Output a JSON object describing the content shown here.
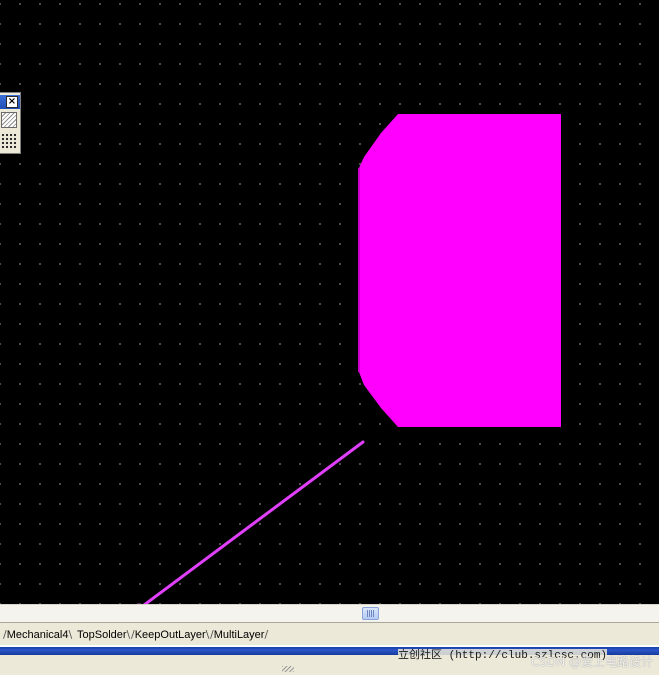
{
  "pcb_view": {
    "background_color": "#000000",
    "grid_dot_color": "#5a5a5a",
    "pad_color": "#ff00ff",
    "arrow_color": "#e040fb",
    "arrow_target": "TopSolder"
  },
  "mini_panel": {
    "close_label": "×",
    "icons": [
      "hatch-pattern-icon",
      "grid-pattern-icon"
    ]
  },
  "layer_tabs": [
    "Mechanical4",
    "TopSolder",
    "KeepOutLayer",
    "MultiLayer"
  ],
  "status": {
    "url_text": "立创社区 (http://club.szlcsc.com)",
    "watermark": "CSDN @爱上电路设计"
  }
}
